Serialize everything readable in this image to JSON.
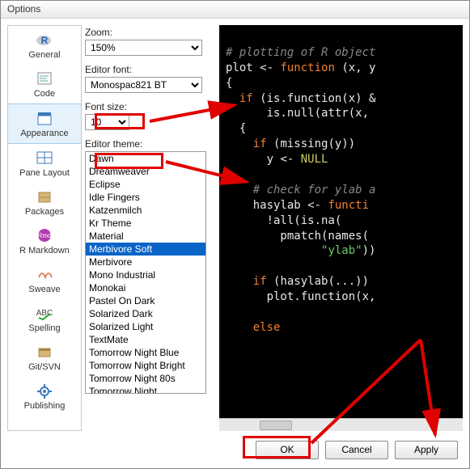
{
  "window_title": "Options",
  "sidebar": {
    "items": [
      {
        "label": "General",
        "icon": "r-logo-icon"
      },
      {
        "label": "Code",
        "icon": "code-icon"
      },
      {
        "label": "Appearance",
        "icon": "appearance-icon",
        "selected": true
      },
      {
        "label": "Pane Layout",
        "icon": "pane-layout-icon"
      },
      {
        "label": "Packages",
        "icon": "packages-icon"
      },
      {
        "label": "R Markdown",
        "icon": "rmarkdown-icon"
      },
      {
        "label": "Sweave",
        "icon": "sweave-icon"
      },
      {
        "label": "Spelling",
        "icon": "spelling-icon"
      },
      {
        "label": "Git/SVN",
        "icon": "gitsvn-icon"
      },
      {
        "label": "Publishing",
        "icon": "publishing-icon"
      }
    ]
  },
  "settings": {
    "zoom_label": "Zoom:",
    "zoom_value": "150%",
    "font_label": "Editor font:",
    "font_value": "Monospac821 BT",
    "fontsize_label": "Font size:",
    "fontsize_value": "10",
    "theme_label": "Editor theme:",
    "themes": [
      "Dawn",
      "Dreamweaver",
      "Eclipse",
      "Idle Fingers",
      "Katzenmilch",
      "Kr Theme",
      "Material",
      "Merbivore Soft",
      "Merbivore",
      "Mono Industrial",
      "Monokai",
      "Pastel On Dark",
      "Solarized Dark",
      "Solarized Light",
      "TextMate",
      "Tomorrow Night Blue",
      "Tomorrow Night Bright",
      "Tomorrow Night 80s",
      "Tomorrow Night"
    ],
    "theme_selected": "Merbivore Soft"
  },
  "preview_code": {
    "l1": "# plotting of R object",
    "l2a": "plot ",
    "l2b": "<-",
    "l2c": " function ",
    "l2d": "(x, y",
    "l3": "{",
    "l4a": "  if ",
    "l4b": "(is.function(x) &",
    "l5a": "      is.null(attr(x,",
    "l6": "  {",
    "l7a": "    if ",
    "l7b": "(missing(y))",
    "l8a": "      y ",
    "l8b": "<-",
    "l8c": " NULL",
    "l10": "    # check for ylab a",
    "l11a": "    hasylab ",
    "l11b": "<-",
    "l11c": " functi",
    "l12": "      !all(is.na(",
    "l13": "        pmatch(names(",
    "l14a": "              ",
    "l14b": "\"ylab\"",
    "l14c": "))",
    "l16a": "    if ",
    "l16b": "(hasylab(...))",
    "l17": "      plot.function(x,",
    "l19": "    else"
  },
  "buttons": {
    "ok": "OK",
    "cancel": "Cancel",
    "apply": "Apply"
  }
}
